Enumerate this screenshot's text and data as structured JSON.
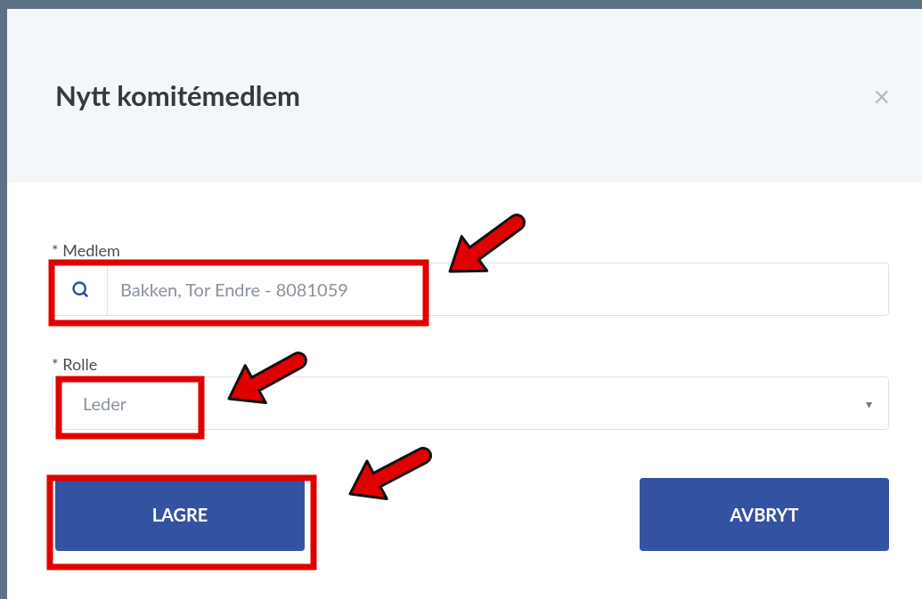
{
  "dialog": {
    "title": "Nytt komitémedlem",
    "close": "×"
  },
  "fields": [
    {
      "kind": "search",
      "label": "* Medlem",
      "value": "Bakken, Tor Endre - 8081059"
    },
    {
      "kind": "select",
      "label": "* Rolle",
      "value": "Leder",
      "caret": "▾"
    }
  ],
  "buttons": [
    "LAGRE",
    "AVBRYT"
  ]
}
